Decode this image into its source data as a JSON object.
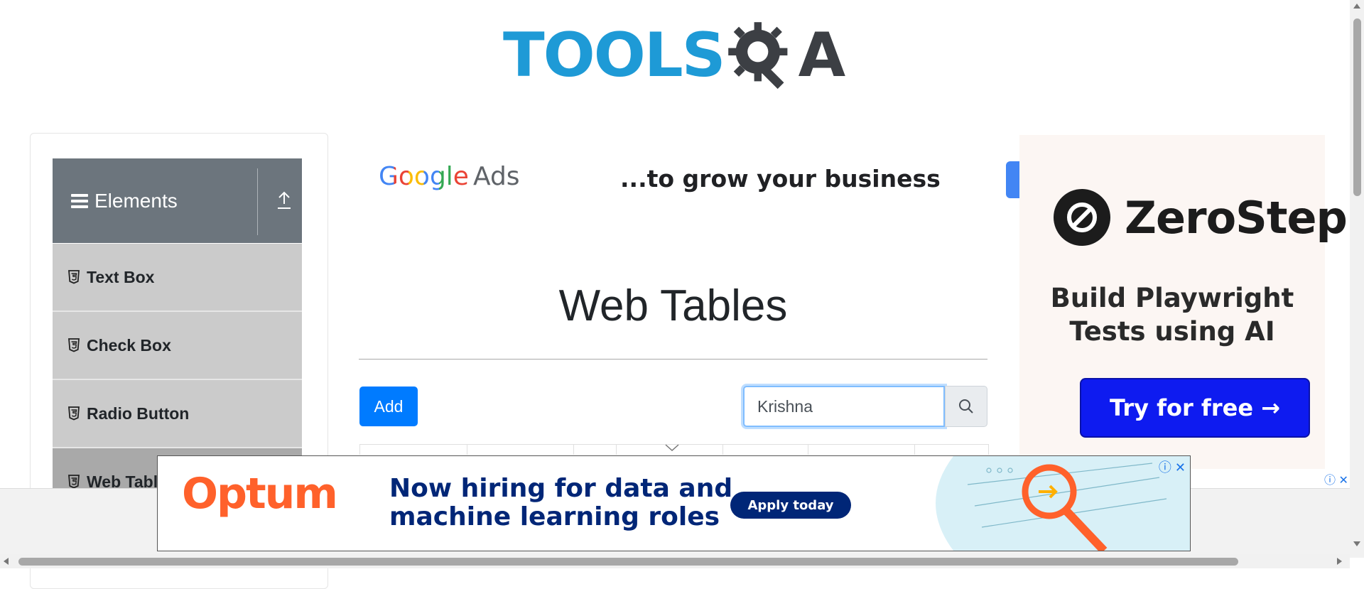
{
  "header": {
    "logo_part1": "TOOLS",
    "logo_part2": "A"
  },
  "sidebar": {
    "group_title": "Elements",
    "items": [
      {
        "label": "Text Box"
      },
      {
        "label": "Check Box"
      },
      {
        "label": "Radio Button"
      },
      {
        "label": "Web Tables"
      }
    ]
  },
  "google_ad": {
    "brand": "Google",
    "brand_suffix": "Ads",
    "tagline": "...to grow your business"
  },
  "main": {
    "title": "Web Tables",
    "add_label": "Add",
    "search_value": "Krishna"
  },
  "right_ad": {
    "brand": "ZeroStep",
    "headline_line1": "Build Playwright",
    "headline_line2": "Tests using AI",
    "cta": "Try for free →"
  },
  "bottom_ad": {
    "brand": "Optum",
    "headline_line1": "Now hiring for data and",
    "headline_line2": "machine learning roles",
    "cta": "Apply today"
  },
  "colors": {
    "primary": "#007bff",
    "sidebar_header": "#6c757d",
    "sidebar_item": "#cbcbcb",
    "logo_blue": "#1e9ad6",
    "optum_orange": "#ff612b",
    "optum_navy": "#002677",
    "zerostep_cta": "#0e1bf0"
  }
}
